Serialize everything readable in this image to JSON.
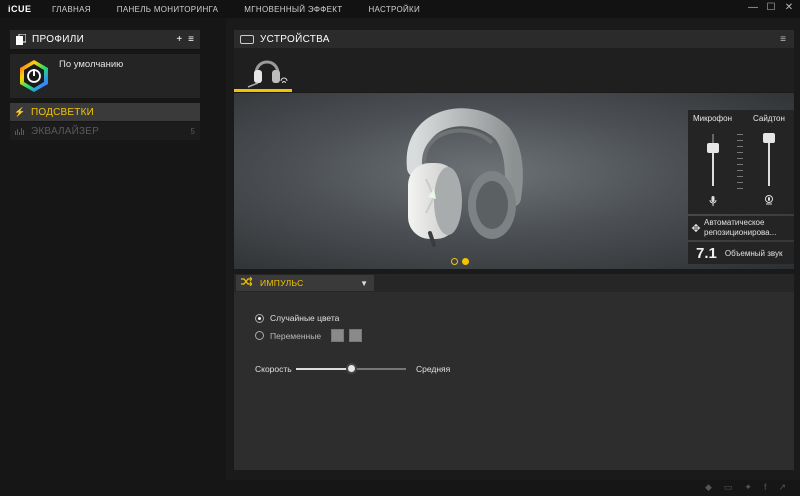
{
  "app": {
    "logo": "iCUE",
    "nav": [
      "ГЛАВНАЯ",
      "ПАНЕЛЬ МОНИТОРИНГА",
      "МГНОВЕННЫЙ ЭФФЕКТ",
      "НАСТРОЙКИ"
    ],
    "window_controls": {
      "minimize": "—",
      "maximize": "☐",
      "close": "✕"
    }
  },
  "profiles": {
    "title": "ПРОФИЛИ",
    "add": "+",
    "menu": "≡",
    "active_profile": "По умолчанию"
  },
  "subnav": {
    "lighting": "ПОДСВЕТКИ",
    "equalizer": "ЭКВАЛАЙЗЕР",
    "equalizer_count": "5"
  },
  "devices": {
    "title": "УСТРОЙСТВА",
    "menu": "≡"
  },
  "audio_panel": {
    "mic_label": "Микрофон",
    "sidetone_label": "Сайдтон",
    "mic_level": 0.65,
    "sidetone_level": 0.85,
    "auto_reposition": "Автоматическое репозиционирова...",
    "surround_badge": "7.1",
    "surround_label": "Объемный звук"
  },
  "pager": {
    "count": 2,
    "active": 2
  },
  "effect": {
    "name": "ИМПУЛЬС",
    "option_random": "Случайные цвета",
    "option_alternating": "Переменные",
    "selected": "random",
    "speed_label": "Скорость",
    "speed_value": "Средняя",
    "speed_level": 0.5
  },
  "colors": {
    "accent": "#f5c400",
    "background": "#1a1a1a",
    "panel": "#2d2d2d"
  }
}
